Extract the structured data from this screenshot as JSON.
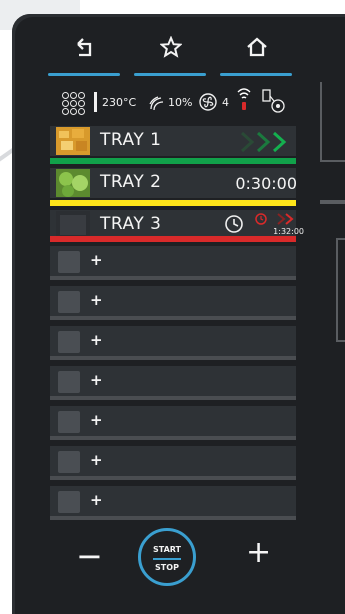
{
  "status": {
    "temperature": "230°C",
    "humidity": "10%",
    "fan_speed": "4"
  },
  "trays": [
    {
      "label": "TRAY 1",
      "time": "",
      "status_color": "#11a14a"
    },
    {
      "label": "TRAY 2",
      "time": "0:30:00",
      "status_color": "#ffe51a"
    },
    {
      "label": "TRAY 3",
      "time": "1:32:00",
      "status_color": "#d92a2a"
    }
  ],
  "empty_slots": [
    {
      "label": "+"
    },
    {
      "label": "+"
    },
    {
      "label": "+"
    },
    {
      "label": "+"
    },
    {
      "label": "+"
    },
    {
      "label": "+"
    },
    {
      "label": "+"
    }
  ],
  "controls": {
    "minus": "−",
    "plus": "+",
    "start": "START",
    "stop": "STOP"
  },
  "colors": {
    "accent": "#3a9fd0",
    "panel": "#1e2023",
    "row": "#2e3236"
  }
}
